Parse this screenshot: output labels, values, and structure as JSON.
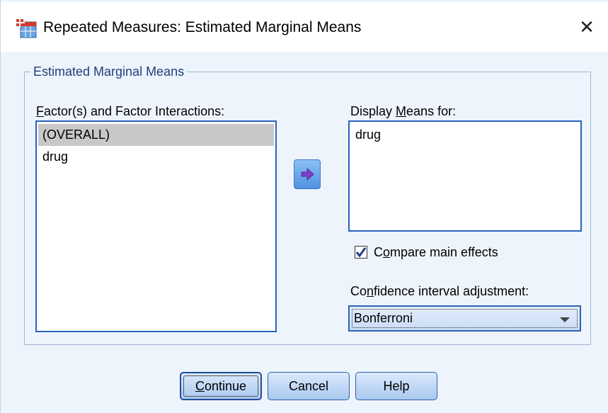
{
  "window": {
    "title": "Repeated Measures: Estimated Marginal Means",
    "close_glyph": "✕"
  },
  "group": {
    "legend": "Estimated Marginal Means"
  },
  "factors": {
    "label_first": "F",
    "label_rest": "actor(s) and Factor Interactions:",
    "items": [
      "(OVERALL)",
      "drug"
    ],
    "selected_index": 0
  },
  "move_button": {
    "icon": "arrow-right-icon"
  },
  "display": {
    "label_start": "Display ",
    "label_mnemonic": "M",
    "label_end": "eans for:",
    "items": [
      "drug"
    ]
  },
  "compare": {
    "label_first": "C",
    "label_mnemonic": "o",
    "label_end": "mpare main effects",
    "checked": true
  },
  "ci": {
    "label_start": "Co",
    "label_mnemonic": "n",
    "label_end": "fidence interval adjustment:",
    "value": "Bonferroni"
  },
  "buttons": {
    "continue_mnemonic": "C",
    "continue_rest": "ontinue",
    "cancel": "Cancel",
    "help": "Help"
  },
  "colors": {
    "dialog_bg": "#eef4fc",
    "accent_border": "#2a63b8",
    "button_gradient_top": "#dbe9fb",
    "button_gradient_bottom": "#a9c8ef",
    "selection": "#c8c8c8"
  }
}
